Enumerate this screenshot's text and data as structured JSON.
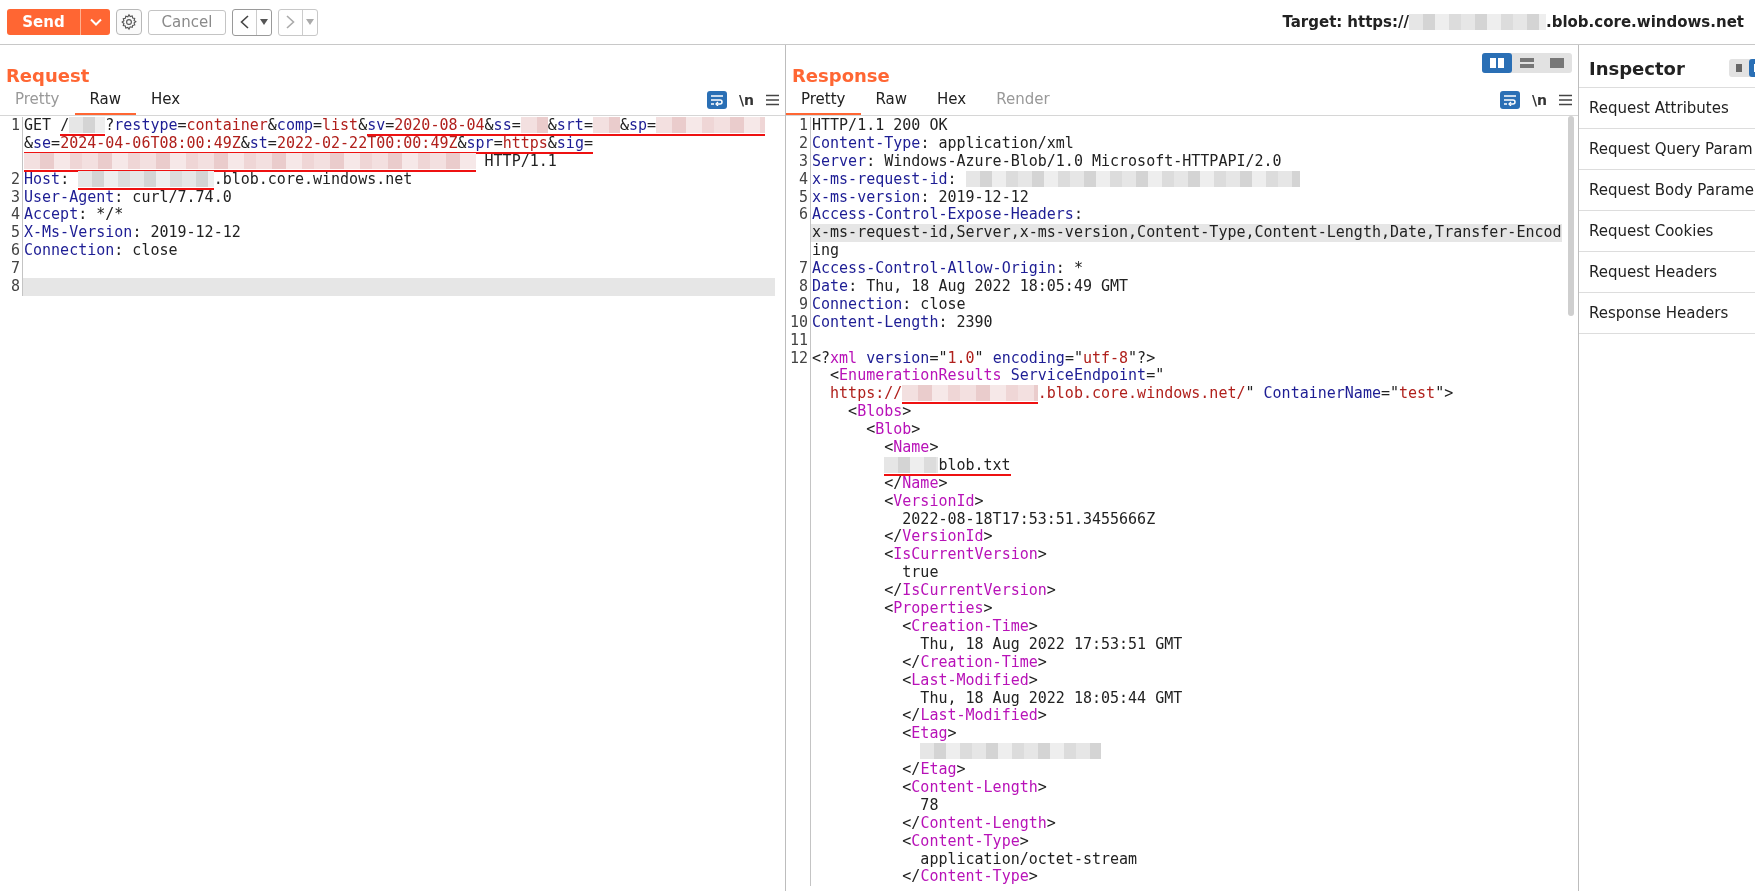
{
  "toolbar": {
    "send": {
      "label": "Send"
    },
    "cancel": {
      "label": "Cancel",
      "disabled": true
    },
    "history": [
      {
        "kind": "back",
        "disabled": false
      },
      {
        "kind": "forward",
        "disabled": true
      }
    ],
    "target": {
      "label": "Target:",
      "scheme": "https://",
      "host_suffix": ".blob.core.windows.net"
    }
  },
  "layout_buttons": [
    {
      "kind": "columns",
      "selected": true
    },
    {
      "kind": "rows",
      "selected": false
    },
    {
      "kind": "single",
      "selected": false
    }
  ],
  "request": {
    "title": "Request",
    "tabs": [
      {
        "label": "Pretty",
        "selected": false,
        "disabled": true
      },
      {
        "label": "Raw",
        "selected": true,
        "disabled": false
      },
      {
        "label": "Hex",
        "selected": false,
        "disabled": false
      }
    ],
    "newline_toggle": "\\n",
    "lines": [
      {
        "number": "1",
        "highlighted": false,
        "segments": [
          {
            "underlined": false,
            "tokens": [
              {
                "kind": "plain",
                "text": "GET "
              }
            ]
          },
          {
            "underlined": true,
            "tokens": [
              {
                "kind": "plain",
                "text": "/"
              },
              {
                "kind": "blur-small-grey"
              }
            ]
          },
          {
            "underlined": false,
            "tokens": [
              {
                "kind": "plain",
                "text": "?"
              },
              {
                "kind": "key",
                "text": "restype"
              },
              {
                "kind": "plain",
                "text": "="
              },
              {
                "kind": "value",
                "text": "container"
              },
              {
                "kind": "plain",
                "text": "&"
              },
              {
                "kind": "key",
                "text": "comp"
              },
              {
                "kind": "plain",
                "text": "="
              },
              {
                "kind": "value",
                "text": "list"
              },
              {
                "kind": "plain",
                "text": "&"
              }
            ]
          },
          {
            "underlined": true,
            "tokens": [
              {
                "kind": "key",
                "text": "sv"
              },
              {
                "kind": "plain",
                "text": "="
              },
              {
                "kind": "value",
                "text": "2020-08-04"
              },
              {
                "kind": "plain",
                "text": "&"
              },
              {
                "kind": "key",
                "text": "ss"
              },
              {
                "kind": "plain",
                "text": "="
              },
              {
                "kind": "blur-tiny-pink"
              },
              {
                "kind": "plain",
                "text": "&"
              },
              {
                "kind": "key",
                "text": "srt"
              },
              {
                "kind": "plain",
                "text": "="
              },
              {
                "kind": "blur-tiny-pink"
              },
              {
                "kind": "plain",
                "text": "&"
              },
              {
                "kind": "key",
                "text": "sp"
              },
              {
                "kind": "plain",
                "text": "="
              },
              {
                "kind": "blur-medium-pink"
              }
            ]
          }
        ]
      },
      {
        "highlighted": false,
        "segments": [
          {
            "underlined": true,
            "tokens": [
              {
                "kind": "plain",
                "text": "&"
              },
              {
                "kind": "key",
                "text": "se"
              },
              {
                "kind": "plain",
                "text": "="
              },
              {
                "kind": "value",
                "text": "2024-04-06T08:00:49Z"
              },
              {
                "kind": "plain",
                "text": "&"
              },
              {
                "kind": "key",
                "text": "st"
              },
              {
                "kind": "plain",
                "text": "="
              },
              {
                "kind": "value",
                "text": "2022-02-22T00:00:49Z"
              },
              {
                "kind": "plain",
                "text": "&"
              },
              {
                "kind": "key",
                "text": "spr"
              },
              {
                "kind": "plain",
                "text": "="
              },
              {
                "kind": "value",
                "text": "https"
              },
              {
                "kind": "plain",
                "text": "&"
              },
              {
                "kind": "key",
                "text": "sig"
              },
              {
                "kind": "plain",
                "text": "="
              }
            ]
          }
        ]
      },
      {
        "highlighted": false,
        "segments": [
          {
            "underlined": true,
            "tokens": [
              {
                "kind": "blur-full-pink"
              }
            ]
          },
          {
            "underlined": false,
            "tokens": [
              {
                "kind": "plain",
                "text": " HTTP/1.1"
              }
            ]
          }
        ]
      },
      {
        "number": "2",
        "highlighted": false,
        "segments": [
          {
            "underlined": false,
            "tokens": [
              {
                "kind": "key",
                "text": "Host"
              },
              {
                "kind": "plain",
                "text": ": "
              }
            ]
          },
          {
            "underlined": true,
            "tokens": [
              {
                "kind": "blur-long-grey"
              }
            ]
          },
          {
            "underlined": false,
            "tokens": [
              {
                "kind": "plain",
                "text": ".blob.core.windows.net"
              }
            ]
          }
        ]
      },
      {
        "number": "3",
        "highlighted": false,
        "segments": [
          {
            "underlined": false,
            "tokens": [
              {
                "kind": "key",
                "text": "User-Agent"
              },
              {
                "kind": "plain",
                "text": ": curl/7.74.0"
              }
            ]
          }
        ]
      },
      {
        "number": "4",
        "highlighted": false,
        "segments": [
          {
            "underlined": false,
            "tokens": [
              {
                "kind": "key",
                "text": "Accept"
              },
              {
                "kind": "plain",
                "text": ": */*"
              }
            ]
          }
        ]
      },
      {
        "number": "5",
        "highlighted": false,
        "segments": [
          {
            "underlined": false,
            "tokens": [
              {
                "kind": "key",
                "text": "X-Ms-Version"
              },
              {
                "kind": "plain",
                "text": ": 2019-12-12"
              }
            ]
          }
        ]
      },
      {
        "number": "6",
        "highlighted": false,
        "segments": [
          {
            "underlined": false,
            "tokens": [
              {
                "kind": "key",
                "text": "Connection"
              },
              {
                "kind": "plain",
                "text": ": close"
              }
            ]
          }
        ]
      },
      {
        "number": "7",
        "highlighted": false
      },
      {
        "number": "8",
        "highlighted": true
      }
    ]
  },
  "response": {
    "title": "Response",
    "tabs": [
      {
        "label": "Pretty",
        "selected": true,
        "disabled": false
      },
      {
        "label": "Raw",
        "selected": false,
        "disabled": false
      },
      {
        "label": "Hex",
        "selected": false,
        "disabled": false
      },
      {
        "label": "Render",
        "selected": false,
        "disabled": true
      }
    ],
    "newline_toggle": "\\n",
    "lines": [
      {
        "number": "1",
        "highlighted": false,
        "segments": [
          {
            "underlined": false,
            "tokens": [
              {
                "kind": "plain",
                "text": "HTTP/1.1 200 OK"
              }
            ]
          }
        ]
      },
      {
        "number": "2",
        "highlighted": false,
        "segments": [
          {
            "underlined": false,
            "tokens": [
              {
                "kind": "key",
                "text": "Content-Type"
              },
              {
                "kind": "plain",
                "text": ": application/xml"
              }
            ]
          }
        ]
      },
      {
        "number": "3",
        "highlighted": false,
        "segments": [
          {
            "underlined": false,
            "tokens": [
              {
                "kind": "key",
                "text": "Server"
              },
              {
                "kind": "plain",
                "text": ": Windows-Azure-Blob/1.0 Microsoft-HTTPAPI/2.0"
              }
            ]
          }
        ]
      },
      {
        "number": "4",
        "highlighted": false,
        "segments": [
          {
            "underlined": false,
            "tokens": [
              {
                "kind": "key",
                "text": "x-ms-request-id"
              },
              {
                "kind": "plain",
                "text": ": "
              },
              {
                "kind": "blur-xlong-grey"
              }
            ]
          }
        ]
      },
      {
        "number": "5",
        "highlighted": false,
        "segments": [
          {
            "underlined": false,
            "tokens": [
              {
                "kind": "key",
                "text": "x-ms-version"
              },
              {
                "kind": "plain",
                "text": ": 2019-12-12"
              }
            ]
          }
        ]
      },
      {
        "number": "6",
        "highlighted": false,
        "segments": [
          {
            "underlined": false,
            "tokens": [
              {
                "kind": "key",
                "text": "Access-Control-Expose-Headers"
              },
              {
                "kind": "plain",
                "text": ":"
              }
            ]
          }
        ]
      },
      {
        "highlighted": true,
        "segments": [
          {
            "underlined": false,
            "tokens": [
              {
                "kind": "plain",
                "text": "x-ms-request-id,Server,x-ms-version,Content-Type,Content-Length,Date,Transfer-Encod"
              }
            ]
          }
        ]
      },
      {
        "highlighted": false,
        "segments": [
          {
            "underlined": false,
            "tokens": [
              {
                "kind": "plain",
                "text": "ing"
              }
            ]
          }
        ]
      },
      {
        "number": "7",
        "highlighted": false,
        "segments": [
          {
            "underlined": false,
            "tokens": [
              {
                "kind": "key",
                "text": "Access-Control-Allow-Origin"
              },
              {
                "kind": "plain",
                "text": ": *"
              }
            ]
          }
        ]
      },
      {
        "number": "8",
        "highlighted": false,
        "segments": [
          {
            "underlined": false,
            "tokens": [
              {
                "kind": "key",
                "text": "Date"
              },
              {
                "kind": "plain",
                "text": ": Thu, 18 Aug 2022 18:05:49 GMT"
              }
            ]
          }
        ]
      },
      {
        "number": "9",
        "highlighted": false,
        "segments": [
          {
            "underlined": false,
            "tokens": [
              {
                "kind": "key",
                "text": "Connection"
              },
              {
                "kind": "plain",
                "text": ": close"
              }
            ]
          }
        ]
      },
      {
        "number": "10",
        "highlighted": false,
        "segments": [
          {
            "underlined": false,
            "tokens": [
              {
                "kind": "key",
                "text": "Content-Length"
              },
              {
                "kind": "plain",
                "text": ": 2390"
              }
            ]
          }
        ]
      },
      {
        "number": "11",
        "highlighted": false
      },
      {
        "number": "12",
        "highlighted": false,
        "segments": [
          {
            "underlined": false,
            "tokens": [
              {
                "kind": "plain",
                "text": "<?"
              },
              {
                "kind": "tag",
                "text": "xml"
              },
              {
                "kind": "key",
                "text": " version"
              },
              {
                "kind": "plain",
                "text": "=\""
              },
              {
                "kind": "value",
                "text": "1.0"
              },
              {
                "kind": "plain",
                "text": "\" "
              },
              {
                "kind": "key",
                "text": "encoding"
              },
              {
                "kind": "plain",
                "text": "=\""
              },
              {
                "kind": "value",
                "text": "utf-8"
              },
              {
                "kind": "plain",
                "text": "\"?>"
              }
            ]
          }
        ]
      },
      {
        "highlighted": false,
        "segments": [
          {
            "underlined": false,
            "tokens": [
              {
                "kind": "plain",
                "text": "  <"
              },
              {
                "kind": "tag",
                "text": "EnumerationResults"
              },
              {
                "kind": "key",
                "text": " ServiceEndpoint"
              },
              {
                "kind": "plain",
                "text": "=\""
              }
            ]
          }
        ]
      },
      {
        "highlighted": false,
        "segments": [
          {
            "underlined": false,
            "tokens": [
              {
                "kind": "value",
                "text": "  https://"
              }
            ]
          },
          {
            "underlined": true,
            "tokens": [
              {
                "kind": "blur-long-pink"
              }
            ]
          },
          {
            "underlined": false,
            "tokens": [
              {
                "kind": "value",
                "text": ".blob.core.windows.net/"
              },
              {
                "kind": "plain",
                "text": "\" "
              },
              {
                "kind": "key",
                "text": "ContainerName"
              },
              {
                "kind": "plain",
                "text": "=\""
              },
              {
                "kind": "value",
                "text": "test"
              },
              {
                "kind": "plain",
                "text": "\">"
              }
            ]
          }
        ]
      },
      {
        "highlighted": false,
        "segments": [
          {
            "underlined": false,
            "tokens": [
              {
                "kind": "plain",
                "text": "    <"
              },
              {
                "kind": "tag",
                "text": "Blobs"
              },
              {
                "kind": "plain",
                "text": ">"
              }
            ]
          }
        ]
      },
      {
        "highlighted": false,
        "segments": [
          {
            "underlined": false,
            "tokens": [
              {
                "kind": "plain",
                "text": "      <"
              },
              {
                "kind": "tag",
                "text": "Blob"
              },
              {
                "kind": "plain",
                "text": ">"
              }
            ]
          }
        ]
      },
      {
        "highlighted": false,
        "segments": [
          {
            "underlined": false,
            "tokens": [
              {
                "kind": "plain",
                "text": "        <"
              },
              {
                "kind": "tag",
                "text": "Name"
              },
              {
                "kind": "plain",
                "text": ">"
              }
            ]
          }
        ]
      },
      {
        "highlighted": false,
        "segments": [
          {
            "underlined": true,
            "tokens": [
              {
                "kind": "indent-narrow"
              },
              {
                "kind": "blur-short-grey"
              },
              {
                "kind": "plain",
                "text": "blob.txt"
              }
            ]
          }
        ]
      },
      {
        "highlighted": false,
        "segments": [
          {
            "underlined": false,
            "tokens": [
              {
                "kind": "plain",
                "text": "        </"
              },
              {
                "kind": "tag",
                "text": "Name"
              },
              {
                "kind": "plain",
                "text": ">"
              }
            ]
          }
        ]
      },
      {
        "highlighted": false,
        "segments": [
          {
            "underlined": false,
            "tokens": [
              {
                "kind": "plain",
                "text": "        <"
              },
              {
                "kind": "tag",
                "text": "VersionId"
              },
              {
                "kind": "plain",
                "text": ">"
              }
            ]
          }
        ]
      },
      {
        "highlighted": false,
        "segments": [
          {
            "underlined": false,
            "tokens": [
              {
                "kind": "plain",
                "text": "          2022-08-18T17:53:51.3455666Z"
              }
            ]
          }
        ]
      },
      {
        "highlighted": false,
        "segments": [
          {
            "underlined": false,
            "tokens": [
              {
                "kind": "plain",
                "text": "        </"
              },
              {
                "kind": "tag",
                "text": "VersionId"
              },
              {
                "kind": "plain",
                "text": ">"
              }
            ]
          }
        ]
      },
      {
        "highlighted": false,
        "segments": [
          {
            "underlined": false,
            "tokens": [
              {
                "kind": "plain",
                "text": "        <"
              },
              {
                "kind": "tag",
                "text": "IsCurrentVersion"
              },
              {
                "kind": "plain",
                "text": ">"
              }
            ]
          }
        ]
      },
      {
        "highlighted": false,
        "segments": [
          {
            "underlined": false,
            "tokens": [
              {
                "kind": "plain",
                "text": "          true"
              }
            ]
          }
        ]
      },
      {
        "highlighted": false,
        "segments": [
          {
            "underlined": false,
            "tokens": [
              {
                "kind": "plain",
                "text": "        </"
              },
              {
                "kind": "tag",
                "text": "IsCurrentVersion"
              },
              {
                "kind": "plain",
                "text": ">"
              }
            ]
          }
        ]
      },
      {
        "highlighted": false,
        "segments": [
          {
            "underlined": false,
            "tokens": [
              {
                "kind": "plain",
                "text": "        <"
              },
              {
                "kind": "tag",
                "text": "Properties"
              },
              {
                "kind": "plain",
                "text": ">"
              }
            ]
          }
        ]
      },
      {
        "highlighted": false,
        "segments": [
          {
            "underlined": false,
            "tokens": [
              {
                "kind": "plain",
                "text": "          <"
              },
              {
                "kind": "tag",
                "text": "Creation-Time"
              },
              {
                "kind": "plain",
                "text": ">"
              }
            ]
          }
        ]
      },
      {
        "highlighted": false,
        "segments": [
          {
            "underlined": false,
            "tokens": [
              {
                "kind": "plain",
                "text": "            Thu, 18 Aug 2022 17:53:51 GMT"
              }
            ]
          }
        ]
      },
      {
        "highlighted": false,
        "segments": [
          {
            "underlined": false,
            "tokens": [
              {
                "kind": "plain",
                "text": "          </"
              },
              {
                "kind": "tag",
                "text": "Creation-Time"
              },
              {
                "kind": "plain",
                "text": ">"
              }
            ]
          }
        ]
      },
      {
        "highlighted": false,
        "segments": [
          {
            "underlined": false,
            "tokens": [
              {
                "kind": "plain",
                "text": "          <"
              },
              {
                "kind": "tag",
                "text": "Last-Modified"
              },
              {
                "kind": "plain",
                "text": ">"
              }
            ]
          }
        ]
      },
      {
        "highlighted": false,
        "segments": [
          {
            "underlined": false,
            "tokens": [
              {
                "kind": "plain",
                "text": "            Thu, 18 Aug 2022 18:05:44 GMT"
              }
            ]
          }
        ]
      },
      {
        "highlighted": false,
        "segments": [
          {
            "underlined": false,
            "tokens": [
              {
                "kind": "plain",
                "text": "          </"
              },
              {
                "kind": "tag",
                "text": "Last-Modified"
              },
              {
                "kind": "plain",
                "text": ">"
              }
            ]
          }
        ]
      },
      {
        "highlighted": false,
        "segments": [
          {
            "underlined": false,
            "tokens": [
              {
                "kind": "plain",
                "text": "          <"
              },
              {
                "kind": "tag",
                "text": "Etag"
              },
              {
                "kind": "plain",
                "text": ">"
              }
            ]
          }
        ]
      },
      {
        "highlighted": false,
        "segments": [
          {
            "underlined": false,
            "tokens": [
              {
                "kind": "indent-wide"
              },
              {
                "kind": "blur-wide-grey"
              }
            ]
          }
        ]
      },
      {
        "highlighted": false,
        "segments": [
          {
            "underlined": false,
            "tokens": [
              {
                "kind": "plain",
                "text": "          </"
              },
              {
                "kind": "tag",
                "text": "Etag"
              },
              {
                "kind": "plain",
                "text": ">"
              }
            ]
          }
        ]
      },
      {
        "highlighted": false,
        "segments": [
          {
            "underlined": false,
            "tokens": [
              {
                "kind": "plain",
                "text": "          <"
              },
              {
                "kind": "tag",
                "text": "Content-Length"
              },
              {
                "kind": "plain",
                "text": ">"
              }
            ]
          }
        ]
      },
      {
        "highlighted": false,
        "segments": [
          {
            "underlined": false,
            "tokens": [
              {
                "kind": "plain",
                "text": "            78"
              }
            ]
          }
        ]
      },
      {
        "highlighted": false,
        "segments": [
          {
            "underlined": false,
            "tokens": [
              {
                "kind": "plain",
                "text": "          </"
              },
              {
                "kind": "tag",
                "text": "Content-Length"
              },
              {
                "kind": "plain",
                "text": ">"
              }
            ]
          }
        ]
      },
      {
        "highlighted": false,
        "segments": [
          {
            "underlined": false,
            "tokens": [
              {
                "kind": "plain",
                "text": "          <"
              },
              {
                "kind": "tag",
                "text": "Content-Type"
              },
              {
                "kind": "plain",
                "text": ">"
              }
            ]
          }
        ]
      },
      {
        "highlighted": false,
        "segments": [
          {
            "underlined": false,
            "tokens": [
              {
                "kind": "plain",
                "text": "            application/octet-stream"
              }
            ]
          }
        ]
      },
      {
        "highlighted": false,
        "segments": [
          {
            "underlined": false,
            "tokens": [
              {
                "kind": "plain",
                "text": "          </"
              },
              {
                "kind": "tag",
                "text": "Content-Type"
              },
              {
                "kind": "plain",
                "text": ">"
              }
            ]
          }
        ]
      }
    ]
  },
  "inspector": {
    "title": "Inspector",
    "view_buttons": [
      {
        "kind": "list",
        "selected": false
      },
      {
        "kind": "panel",
        "selected": true
      }
    ],
    "sections": [
      {
        "label": "Request Attributes"
      },
      {
        "label": "Request Query Param"
      },
      {
        "label": "Request Body Parame"
      },
      {
        "label": "Request Cookies"
      },
      {
        "label": "Request Headers"
      },
      {
        "label": "Response Headers"
      }
    ]
  }
}
